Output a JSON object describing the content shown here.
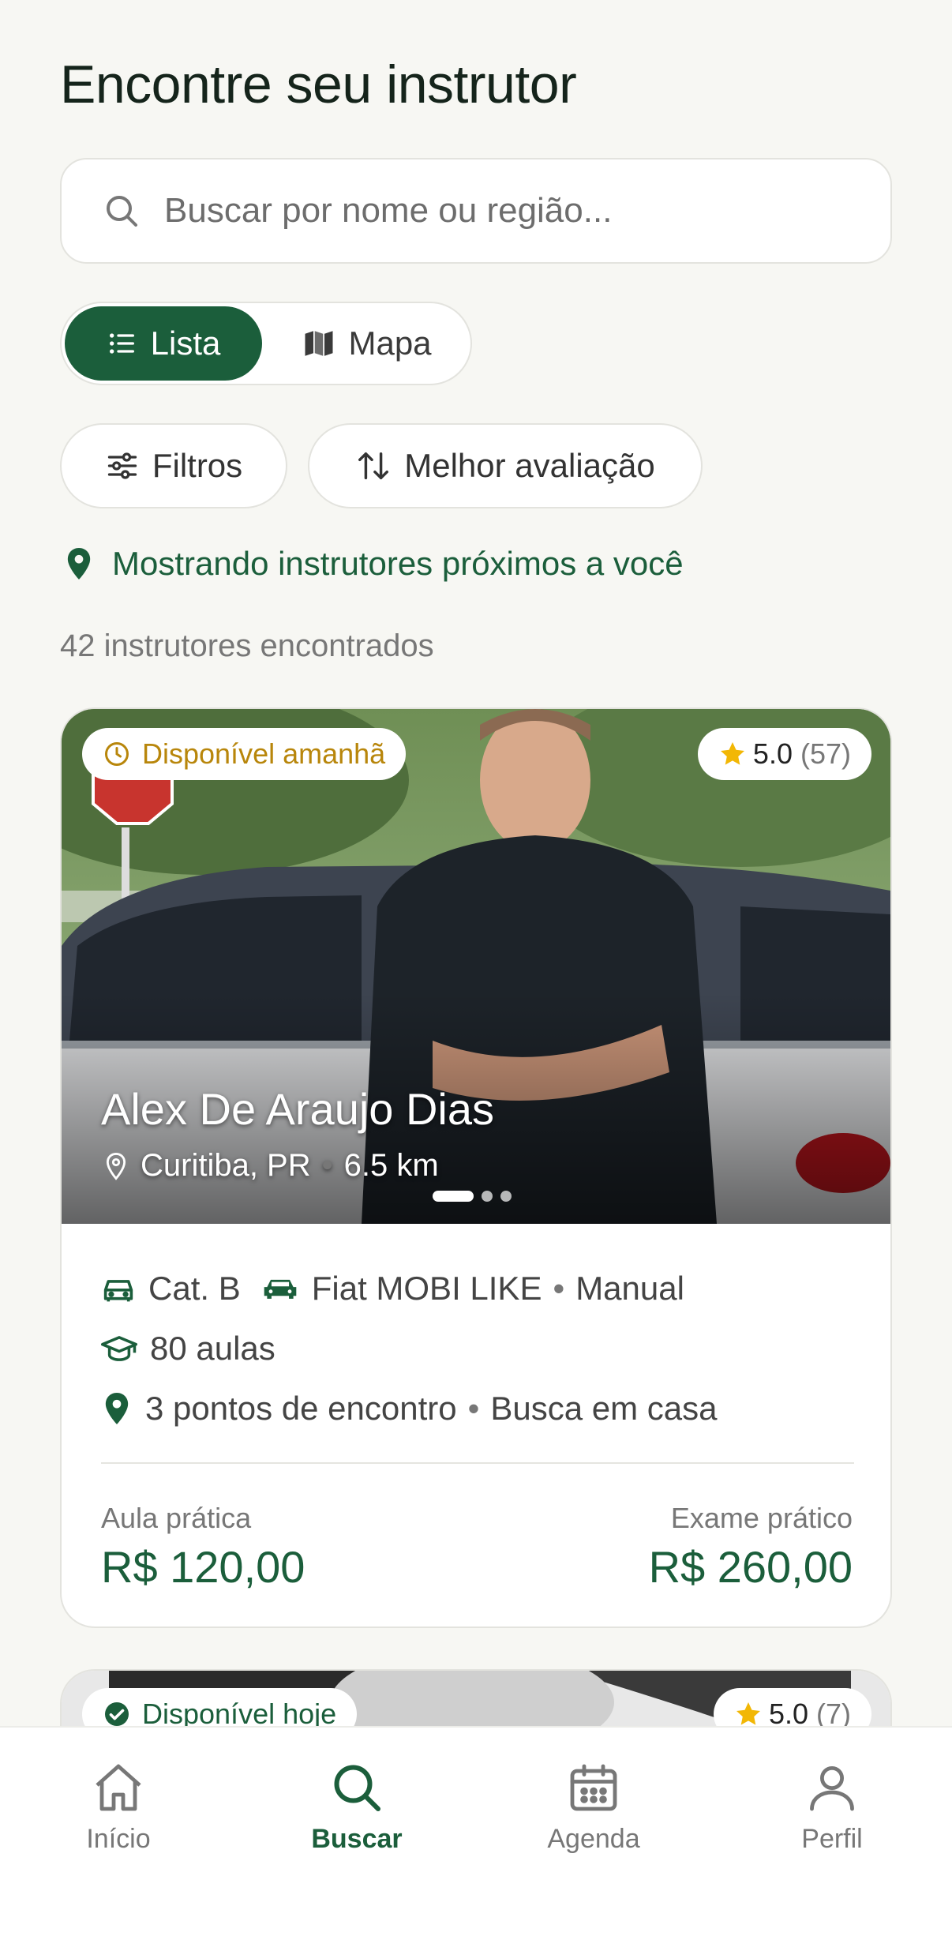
{
  "header": {
    "title": "Encontre seu instrutor"
  },
  "search": {
    "placeholder": "Buscar por nome ou região...",
    "value": ""
  },
  "view_toggle": {
    "options": [
      {
        "label": "Lista",
        "icon": "list-icon",
        "active": true
      },
      {
        "label": "Mapa",
        "icon": "map-icon",
        "active": false
      }
    ]
  },
  "chips": {
    "filters_label": "Filtros",
    "sort_label": "Melhor avaliação"
  },
  "location_note": "Mostrando instrutores próximos a você",
  "results_count": "42 instrutores encontrados",
  "instructors": [
    {
      "availability": "Disponível amanhã",
      "rating": "5.0",
      "reviews": "(57)",
      "name": "Alex De Araujo Dias",
      "location": "Curitiba, PR",
      "distance": "6.5 km",
      "category": "Cat. B",
      "car": "Fiat MOBI LIKE",
      "transmission": "Manual",
      "lessons": "80 aulas",
      "meeting_points": "3 pontos de encontro",
      "pickup": "Busca em casa",
      "price_practical_label": "Aula prática",
      "price_practical": "R$ 120,00",
      "price_exam_label": "Exame prático",
      "price_exam": "R$ 260,00",
      "photo_count": 3,
      "photo_index": 1
    },
    {
      "availability": "Disponível hoje",
      "rating": "5.0",
      "reviews": "(7)"
    }
  ],
  "tabbar": {
    "items": [
      {
        "label": "Início",
        "icon": "home-icon",
        "active": false
      },
      {
        "label": "Buscar",
        "icon": "search-icon",
        "active": true
      },
      {
        "label": "Agenda",
        "icon": "calendar-icon",
        "active": false
      },
      {
        "label": "Perfil",
        "icon": "user-icon",
        "active": false
      }
    ]
  },
  "colors": {
    "primary": "#1b5e3b",
    "background": "#f7f7f3",
    "availability_tomorrow": "#b8860b",
    "star": "#f2b705"
  }
}
